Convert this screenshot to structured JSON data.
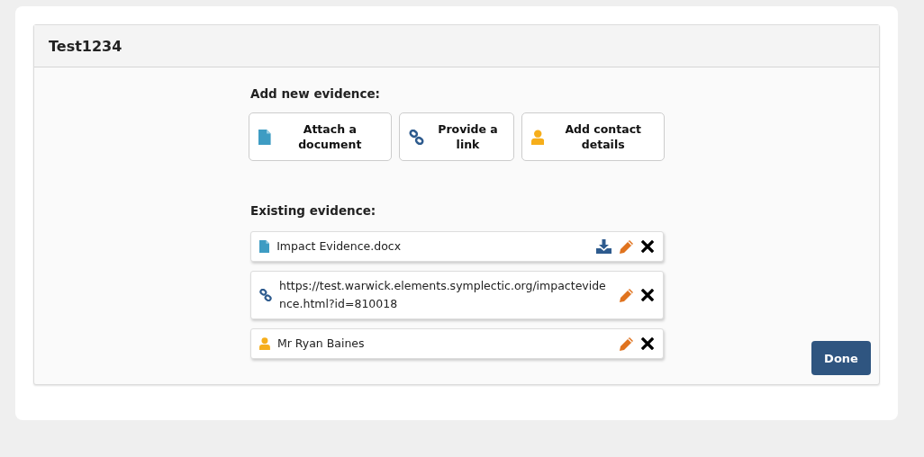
{
  "panel": {
    "title": "Test1234"
  },
  "add_heading": "Add new evidence:",
  "add_options": [
    {
      "kind": "document",
      "label": "Attach a document"
    },
    {
      "kind": "link",
      "label": "Provide a link"
    },
    {
      "kind": "contact",
      "label": "Add contact details"
    }
  ],
  "existing_heading": "Existing evidence:",
  "evidence": [
    {
      "kind": "document",
      "text": "Impact Evidence.docx",
      "downloadable": true
    },
    {
      "kind": "link",
      "text": "https://test.warwick.elements.symplectic.org/impactevidence.html?id=810018",
      "downloadable": false
    },
    {
      "kind": "contact",
      "text": "Mr Ryan Baines",
      "downloadable": false
    }
  ],
  "done_button": "Done"
}
